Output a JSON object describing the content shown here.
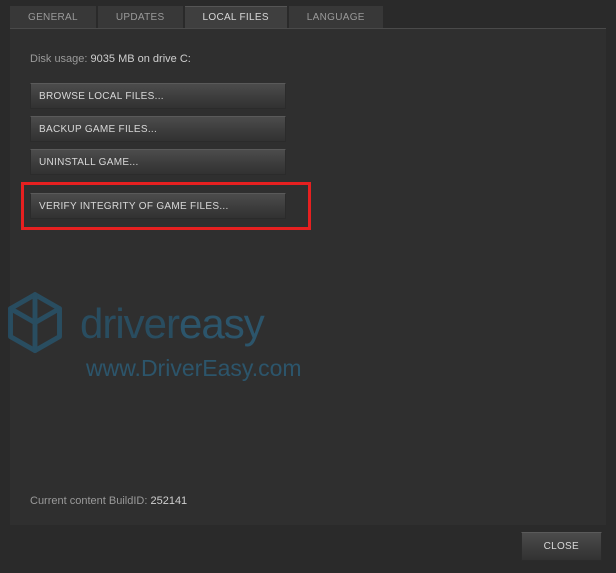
{
  "tabs": {
    "general": "GENERAL",
    "updates": "UPDATES",
    "local_files": "LOCAL FILES",
    "language": "LANGUAGE"
  },
  "disk_usage": {
    "label": "Disk usage",
    "value": "9035 MB on drive C:"
  },
  "buttons": {
    "browse": "BROWSE LOCAL FILES...",
    "backup": "BACKUP GAME FILES...",
    "uninstall": "UNINSTALL GAME...",
    "verify": "VERIFY INTEGRITY OF GAME FILES..."
  },
  "build": {
    "label": "Current content BuildID",
    "value": "252141"
  },
  "footer": {
    "close": "CLOSE"
  },
  "watermark": {
    "brand1": "driver",
    "brand2": "easy",
    "url": "www.DriverEasy.com"
  }
}
